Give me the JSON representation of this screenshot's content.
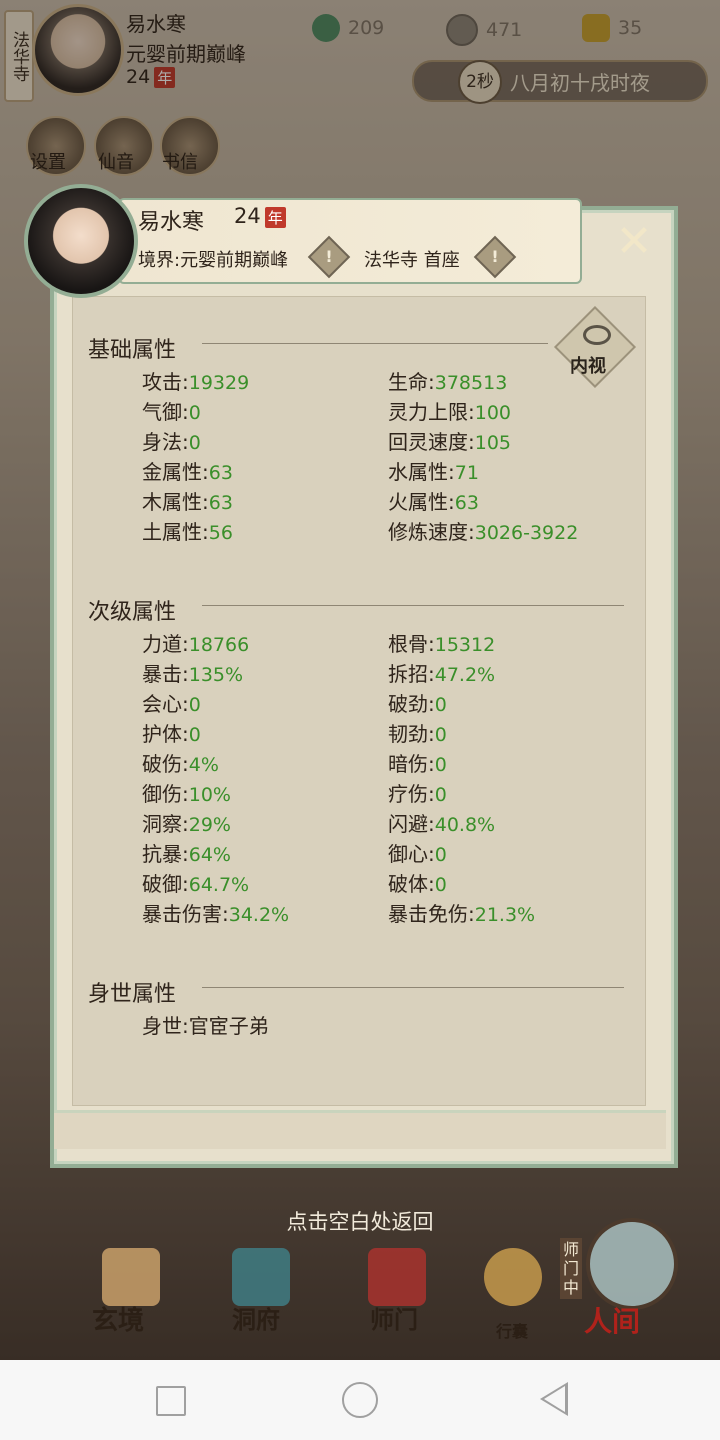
{
  "hud": {
    "sect_tag": "法华寺",
    "name": "易水寒",
    "realm": "元婴前期巅峰",
    "age": "24",
    "nian": "年",
    "resources": [
      {
        "icon": "jade-icon",
        "value": "209"
      },
      {
        "icon": "coin-icon",
        "value": "471"
      },
      {
        "icon": "strength-icon",
        "value": "35"
      }
    ],
    "seconds": "2秒",
    "time_text": "八月初十戌时夜",
    "menu": [
      "设置",
      "仙音",
      "书信"
    ]
  },
  "dialog": {
    "name": "易水寒",
    "age": "24",
    "nian": "年",
    "realm_label": "境界:元婴前期巅峰",
    "sect_label": "法华寺 首座",
    "neishi": "内视",
    "close": "✕",
    "sections": [
      {
        "title": "基础属性",
        "left": [
          {
            "k": "攻击",
            "v": "19329"
          },
          {
            "k": "气御",
            "v": "0"
          },
          {
            "k": "身法",
            "v": "0"
          },
          {
            "k": "金属性",
            "v": "63"
          },
          {
            "k": "木属性",
            "v": "63"
          },
          {
            "k": "土属性",
            "v": "56"
          }
        ],
        "right": [
          {
            "k": "生命",
            "v": "378513"
          },
          {
            "k": "灵力上限",
            "v": "100"
          },
          {
            "k": "回灵速度",
            "v": "105"
          },
          {
            "k": "水属性",
            "v": "71"
          },
          {
            "k": "火属性",
            "v": "63"
          },
          {
            "k": "修炼速度",
            "v": "3026-3922"
          }
        ]
      },
      {
        "title": "次级属性",
        "left": [
          {
            "k": "力道",
            "v": "18766"
          },
          {
            "k": "暴击",
            "v": "135%"
          },
          {
            "k": "会心",
            "v": "0"
          },
          {
            "k": "护体",
            "v": "0"
          },
          {
            "k": "破伤",
            "v": "4%"
          },
          {
            "k": "御伤",
            "v": "10%"
          },
          {
            "k": "洞察",
            "v": "29%"
          },
          {
            "k": "抗暴",
            "v": "64%"
          },
          {
            "k": "破御",
            "v": "64.7%"
          },
          {
            "k": "暴击伤害",
            "v": "34.2%"
          }
        ],
        "right": [
          {
            "k": "根骨",
            "v": "15312"
          },
          {
            "k": "拆招",
            "v": "47.2%"
          },
          {
            "k": "破劲",
            "v": "0"
          },
          {
            "k": "韧劲",
            "v": "0"
          },
          {
            "k": "暗伤",
            "v": "0"
          },
          {
            "k": "疗伤",
            "v": "0"
          },
          {
            "k": "闪避",
            "v": "40.8%"
          },
          {
            "k": "御心",
            "v": "0"
          },
          {
            "k": "破体",
            "v": "0"
          },
          {
            "k": "暴击免伤",
            "v": "21.3%"
          }
        ]
      },
      {
        "title": "身世属性",
        "left": [
          {
            "k": "身世",
            "v": "官宦子弟"
          }
        ],
        "right": []
      }
    ]
  },
  "return_hint": "点击空白处返回",
  "bottom_nav": {
    "items": [
      "玄境",
      "洞府",
      "师门",
      "行囊",
      "人间"
    ],
    "side_tag": "师门中"
  }
}
